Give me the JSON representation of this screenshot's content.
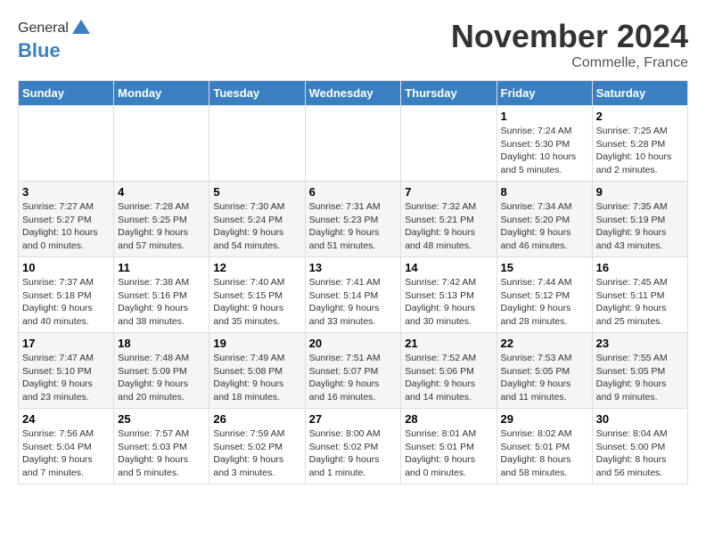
{
  "header": {
    "logo_general": "General",
    "logo_blue": "Blue",
    "month_title": "November 2024",
    "location": "Commelle, France"
  },
  "days_of_week": [
    "Sunday",
    "Monday",
    "Tuesday",
    "Wednesday",
    "Thursday",
    "Friday",
    "Saturday"
  ],
  "weeks": [
    [
      {
        "num": "",
        "info": ""
      },
      {
        "num": "",
        "info": ""
      },
      {
        "num": "",
        "info": ""
      },
      {
        "num": "",
        "info": ""
      },
      {
        "num": "",
        "info": ""
      },
      {
        "num": "1",
        "info": "Sunrise: 7:24 AM\nSunset: 5:30 PM\nDaylight: 10 hours and 5 minutes."
      },
      {
        "num": "2",
        "info": "Sunrise: 7:25 AM\nSunset: 5:28 PM\nDaylight: 10 hours and 2 minutes."
      }
    ],
    [
      {
        "num": "3",
        "info": "Sunrise: 7:27 AM\nSunset: 5:27 PM\nDaylight: 10 hours and 0 minutes."
      },
      {
        "num": "4",
        "info": "Sunrise: 7:28 AM\nSunset: 5:25 PM\nDaylight: 9 hours and 57 minutes."
      },
      {
        "num": "5",
        "info": "Sunrise: 7:30 AM\nSunset: 5:24 PM\nDaylight: 9 hours and 54 minutes."
      },
      {
        "num": "6",
        "info": "Sunrise: 7:31 AM\nSunset: 5:23 PM\nDaylight: 9 hours and 51 minutes."
      },
      {
        "num": "7",
        "info": "Sunrise: 7:32 AM\nSunset: 5:21 PM\nDaylight: 9 hours and 48 minutes."
      },
      {
        "num": "8",
        "info": "Sunrise: 7:34 AM\nSunset: 5:20 PM\nDaylight: 9 hours and 46 minutes."
      },
      {
        "num": "9",
        "info": "Sunrise: 7:35 AM\nSunset: 5:19 PM\nDaylight: 9 hours and 43 minutes."
      }
    ],
    [
      {
        "num": "10",
        "info": "Sunrise: 7:37 AM\nSunset: 5:18 PM\nDaylight: 9 hours and 40 minutes."
      },
      {
        "num": "11",
        "info": "Sunrise: 7:38 AM\nSunset: 5:16 PM\nDaylight: 9 hours and 38 minutes."
      },
      {
        "num": "12",
        "info": "Sunrise: 7:40 AM\nSunset: 5:15 PM\nDaylight: 9 hours and 35 minutes."
      },
      {
        "num": "13",
        "info": "Sunrise: 7:41 AM\nSunset: 5:14 PM\nDaylight: 9 hours and 33 minutes."
      },
      {
        "num": "14",
        "info": "Sunrise: 7:42 AM\nSunset: 5:13 PM\nDaylight: 9 hours and 30 minutes."
      },
      {
        "num": "15",
        "info": "Sunrise: 7:44 AM\nSunset: 5:12 PM\nDaylight: 9 hours and 28 minutes."
      },
      {
        "num": "16",
        "info": "Sunrise: 7:45 AM\nSunset: 5:11 PM\nDaylight: 9 hours and 25 minutes."
      }
    ],
    [
      {
        "num": "17",
        "info": "Sunrise: 7:47 AM\nSunset: 5:10 PM\nDaylight: 9 hours and 23 minutes."
      },
      {
        "num": "18",
        "info": "Sunrise: 7:48 AM\nSunset: 5:09 PM\nDaylight: 9 hours and 20 minutes."
      },
      {
        "num": "19",
        "info": "Sunrise: 7:49 AM\nSunset: 5:08 PM\nDaylight: 9 hours and 18 minutes."
      },
      {
        "num": "20",
        "info": "Sunrise: 7:51 AM\nSunset: 5:07 PM\nDaylight: 9 hours and 16 minutes."
      },
      {
        "num": "21",
        "info": "Sunrise: 7:52 AM\nSunset: 5:06 PM\nDaylight: 9 hours and 14 minutes."
      },
      {
        "num": "22",
        "info": "Sunrise: 7:53 AM\nSunset: 5:05 PM\nDaylight: 9 hours and 11 minutes."
      },
      {
        "num": "23",
        "info": "Sunrise: 7:55 AM\nSunset: 5:05 PM\nDaylight: 9 hours and 9 minutes."
      }
    ],
    [
      {
        "num": "24",
        "info": "Sunrise: 7:56 AM\nSunset: 5:04 PM\nDaylight: 9 hours and 7 minutes."
      },
      {
        "num": "25",
        "info": "Sunrise: 7:57 AM\nSunset: 5:03 PM\nDaylight: 9 hours and 5 minutes."
      },
      {
        "num": "26",
        "info": "Sunrise: 7:59 AM\nSunset: 5:02 PM\nDaylight: 9 hours and 3 minutes."
      },
      {
        "num": "27",
        "info": "Sunrise: 8:00 AM\nSunset: 5:02 PM\nDaylight: 9 hours and 1 minute."
      },
      {
        "num": "28",
        "info": "Sunrise: 8:01 AM\nSunset: 5:01 PM\nDaylight: 9 hours and 0 minutes."
      },
      {
        "num": "29",
        "info": "Sunrise: 8:02 AM\nSunset: 5:01 PM\nDaylight: 8 hours and 58 minutes."
      },
      {
        "num": "30",
        "info": "Sunrise: 8:04 AM\nSunset: 5:00 PM\nDaylight: 8 hours and 56 minutes."
      }
    ]
  ]
}
